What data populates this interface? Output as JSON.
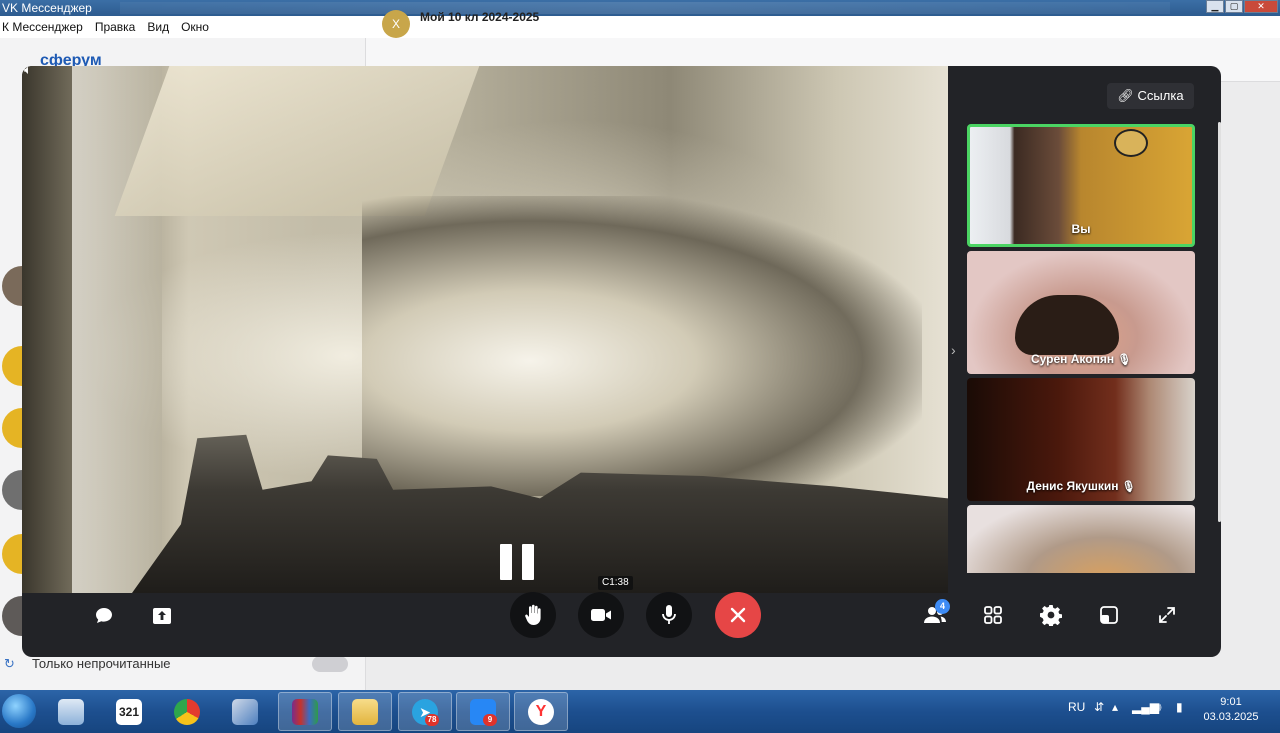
{
  "window": {
    "title": "VK Мессенджер",
    "minimize": "▁",
    "maximize": "▢",
    "close": "✕"
  },
  "menu": [
    "Правка",
    "Вид",
    "Окно"
  ],
  "menu_first": "К Мессенджер",
  "background_app": {
    "brand": "сферум",
    "chat_title": "Мой 10 кл 2024-2025",
    "chat_avatar": "Х",
    "only_unread_label": "Только непрочитанные"
  },
  "call": {
    "link_button": "Ссылка",
    "timer": "С1:38",
    "participant_count_badge": "4",
    "participants": [
      {
        "name": "Вы",
        "mic_muted": false
      },
      {
        "name": "Сурен Акопян",
        "mic_muted": true
      },
      {
        "name": "Денис Якушкин",
        "mic_muted": true
      },
      {
        "name": "",
        "mic_muted": false
      }
    ],
    "colors": {
      "panel_bg": "#222327",
      "end_call": "#e64646",
      "active_speaker": "#4bd463",
      "badge": "#3d8bf5"
    },
    "icons": {
      "chat": "chat-bubble-icon",
      "share": "share-screen-icon",
      "raise_hand": "hand-icon",
      "camera": "camera-icon",
      "mic": "microphone-icon",
      "end_call": "close-icon",
      "participants": "people-icon",
      "grid": "grid-icon",
      "settings": "gear-icon",
      "pip": "picture-in-picture-icon",
      "fullscreen": "expand-icon"
    }
  },
  "taskbar": {
    "telegram_badge": "78",
    "messenger_badge": "9",
    "calendar_day": "321",
    "language": "RU",
    "time": "9:01",
    "date": "03.03.2025"
  }
}
